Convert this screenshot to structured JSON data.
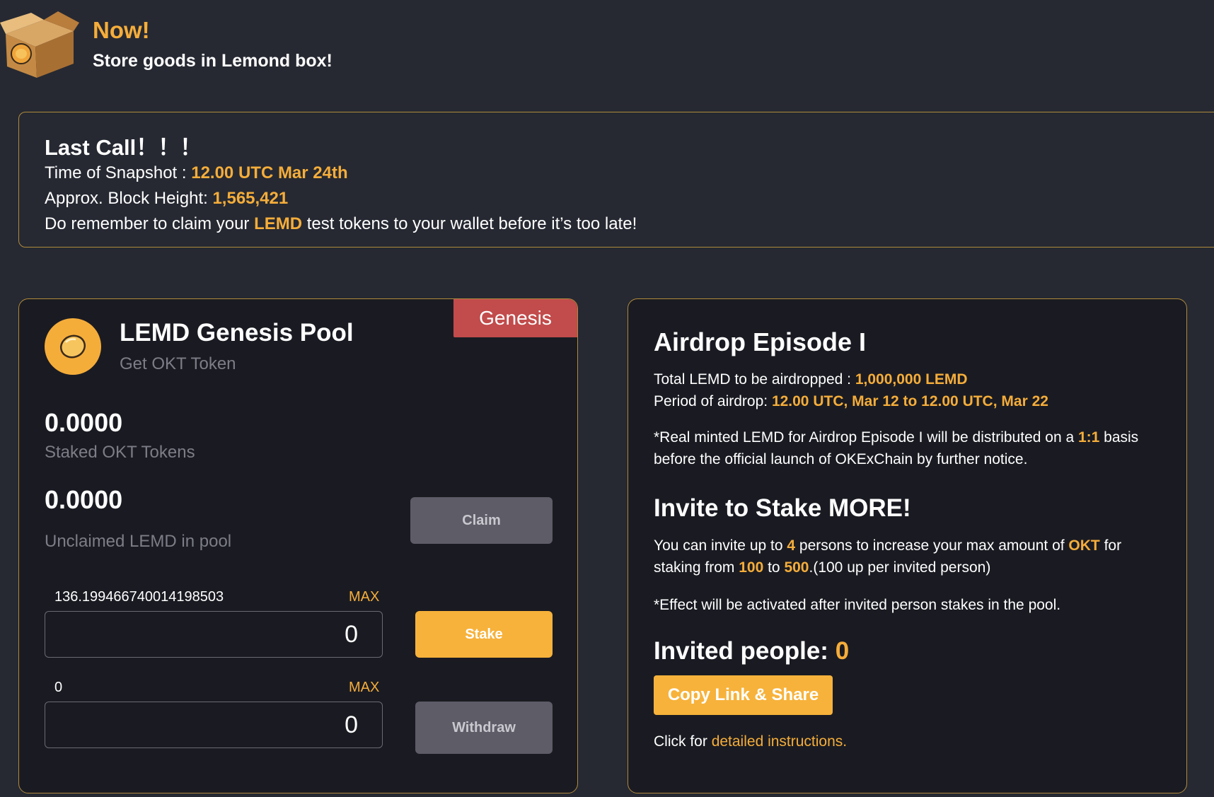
{
  "promo": {
    "now": "Now!",
    "subtitle": "Store goods in Lemond box!"
  },
  "last_call": {
    "title": "Last Call！！！",
    "snapshot_label": "Time of Snapshot : ",
    "snapshot_value": "12.00 UTC Mar 24th",
    "block_label": "Approx. Block Height: ",
    "block_value": "1,565,421",
    "reminder_pre": "Do remember to claim your ",
    "reminder_token": "LEMD",
    "reminder_post": " test tokens to your wallet before it’s too late!"
  },
  "pool": {
    "tag": "Genesis",
    "title": "LEMD Genesis Pool",
    "subtitle": "Get OKT Token",
    "staked_value": "0.0000",
    "staked_label": "Staked OKT Tokens",
    "unclaimed_value": "0.0000",
    "unclaimed_label": "Unclaimed LEMD in pool",
    "claim_label": "Claim",
    "stake_balance": "136.199466740014198503",
    "stake_max": "MAX",
    "stake_input_value": "0",
    "stake_label": "Stake",
    "withdraw_balance": "0",
    "withdraw_max": "MAX",
    "withdraw_input_value": "0",
    "withdraw_label": "Withdraw"
  },
  "airdrop": {
    "title": "Airdrop Episode I",
    "total_label": "Total LEMD to be airdropped : ",
    "total_value": "1,000,000 LEMD",
    "period_label": "Period of airdrop: ",
    "period_value": "12.00 UTC, Mar 12 to 12.00 UTC, Mar 22",
    "note_pre": "*Real minted LEMD for Airdrop Episode I will be distributed on a ",
    "note_ratio": "1:1",
    "note_post": " basis before the official launch of OKExChain by further notice.",
    "invite_title": "Invite to Stake MORE!",
    "invite_pre": "You can invite up to ",
    "invite_count": "4",
    "invite_mid": " persons to increase your max amount of ",
    "invite_token": "OKT",
    "invite_mid2": " for staking from ",
    "invite_from": "100",
    "invite_to_word": " to ",
    "invite_to": "500",
    "invite_post": ".(100 up per invited person)",
    "effect_note": "*Effect will be activated after invited person stakes in the pool.",
    "invited_label": "Invited people: ",
    "invited_value": "0",
    "copy_label": "Copy Link & Share",
    "click_pre": "Click for ",
    "click_link": "detailed instructions."
  },
  "colors": {
    "background": "#262932",
    "card": "#1a1b22",
    "accent": "#f5ad3a",
    "genesis_tag": "#c24b4b",
    "border": "#b08a3c"
  }
}
